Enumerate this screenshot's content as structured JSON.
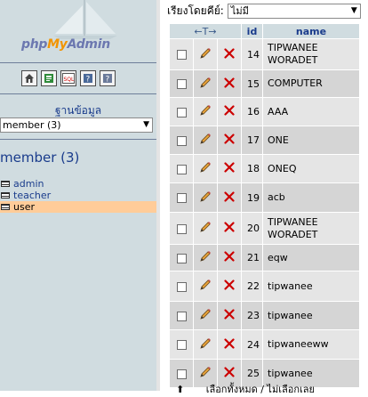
{
  "nav": {
    "logo": {
      "php": "php",
      "my": "My",
      "admin": "Admin"
    },
    "db_label": "ฐานข้อมูล",
    "db_select_value": "member  (3)",
    "db_heading": "member (3)",
    "tables": [
      {
        "name": "admin",
        "active": false
      },
      {
        "name": "teacher",
        "active": false
      },
      {
        "name": "user",
        "active": true
      }
    ]
  },
  "main": {
    "sort_label": "เรียงโดยคีย์:",
    "sort_value": "ไม่มี",
    "header": {
      "arrows": "←T→",
      "id": "id",
      "name": "name"
    },
    "rows": [
      {
        "id": "14",
        "name": "TIPWANEE WORADET"
      },
      {
        "id": "15",
        "name": "COMPUTER"
      },
      {
        "id": "16",
        "name": "AAA"
      },
      {
        "id": "17",
        "name": "ONE"
      },
      {
        "id": "18",
        "name": "ONEQ"
      },
      {
        "id": "19",
        "name": "acb"
      },
      {
        "id": "20",
        "name": "TIPWANEE WORADET"
      },
      {
        "id": "21",
        "name": "eqw"
      },
      {
        "id": "22",
        "name": "tipwanee"
      },
      {
        "id": "23",
        "name": "tipwanee"
      },
      {
        "id": "24",
        "name": "tipwaneeww"
      },
      {
        "id": "25",
        "name": "tipwanee"
      }
    ],
    "bottom_hint": "เลือกทั้งหมด / ไม่เลือกเลย"
  },
  "colors": {
    "nav_bg": "#d0dce0",
    "link": "#1a3c8c",
    "active_row": "#ffcc99",
    "delete_x": "#cc0000"
  }
}
